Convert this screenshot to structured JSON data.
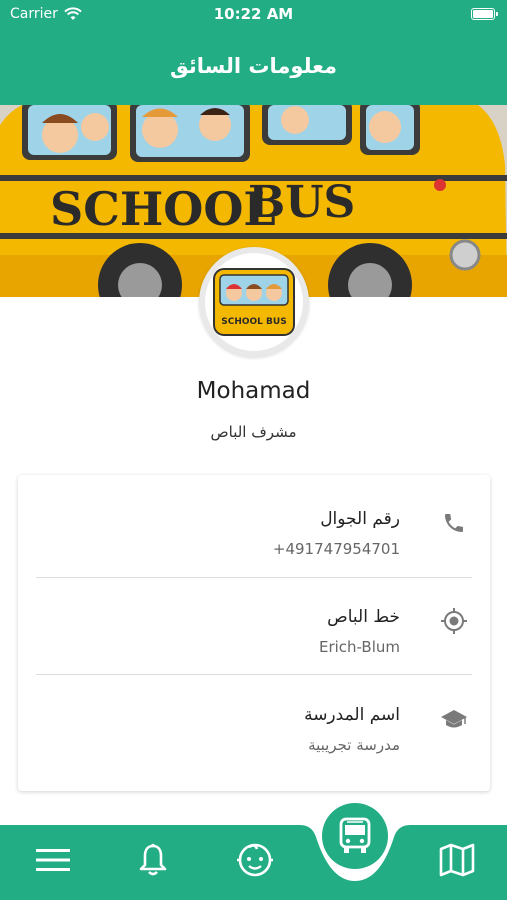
{
  "status_bar": {
    "carrier": "Carrier",
    "time": "10:22 AM"
  },
  "header": {
    "title": "معلومات السائق"
  },
  "banner": {
    "bus_text_1": "SCHOOL",
    "bus_text_2": "BUS"
  },
  "avatar": {
    "badge_text": "SCHOOL BUS"
  },
  "profile": {
    "name": "Mohamad",
    "role": "مشرف الباص"
  },
  "details": [
    {
      "label": "رقم الجوال",
      "value": "+491747954701",
      "icon": "phone-icon"
    },
    {
      "label": "خط الباص",
      "value": "Erich-Blum",
      "icon": "location-target-icon"
    },
    {
      "label": "اسم المدرسة",
      "value": "مدرسة تجريبية",
      "icon": "graduation-cap-icon"
    }
  ],
  "bottom_nav": [
    "menu-icon",
    "bell-icon",
    "child-face-icon",
    "bus-icon",
    "map-icon"
  ],
  "colors": {
    "accent": "#22ad85",
    "icon_gray": "#7a7a7a"
  }
}
